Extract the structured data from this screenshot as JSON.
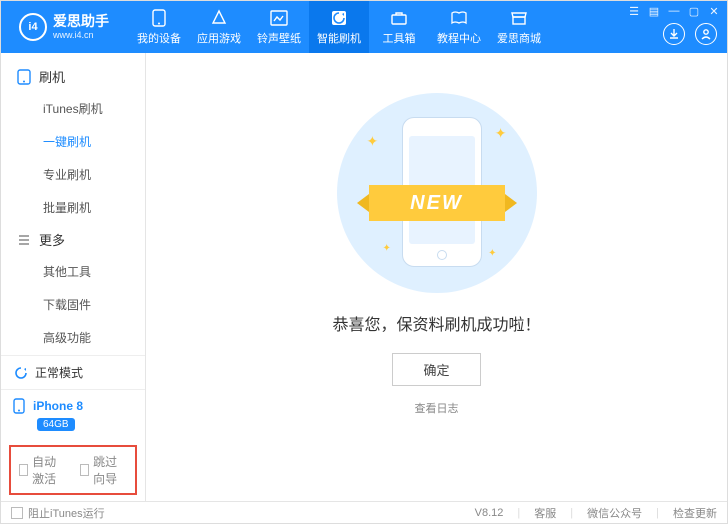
{
  "app": {
    "name": "爱思助手",
    "site": "www.i4.cn",
    "logo_text": "i4"
  },
  "topnav": [
    {
      "label": "我的设备"
    },
    {
      "label": "应用游戏"
    },
    {
      "label": "铃声壁纸"
    },
    {
      "label": "智能刷机"
    },
    {
      "label": "工具箱"
    },
    {
      "label": "教程中心"
    },
    {
      "label": "爱思商城"
    }
  ],
  "sidebar": {
    "group1": {
      "title": "刷机",
      "items": [
        "iTunes刷机",
        "一键刷机",
        "专业刷机",
        "批量刷机"
      ],
      "active_index": 1
    },
    "group2": {
      "title": "更多",
      "items": [
        "其他工具",
        "下载固件",
        "高级功能"
      ]
    },
    "status_label": "正常模式",
    "device": {
      "name": "iPhone 8",
      "storage": "64GB"
    },
    "bottom": {
      "auto_activate": "自动激活",
      "skip_guide": "跳过向导"
    }
  },
  "main": {
    "ribbon_text": "NEW",
    "success_text": "恭喜您，保资料刷机成功啦！",
    "ok_label": "确定",
    "log_link": "查看日志"
  },
  "footer": {
    "block_itunes": "阻止iTunes运行",
    "version": "V8.12",
    "support": "客服",
    "wechat": "微信公众号",
    "update": "检查更新"
  }
}
